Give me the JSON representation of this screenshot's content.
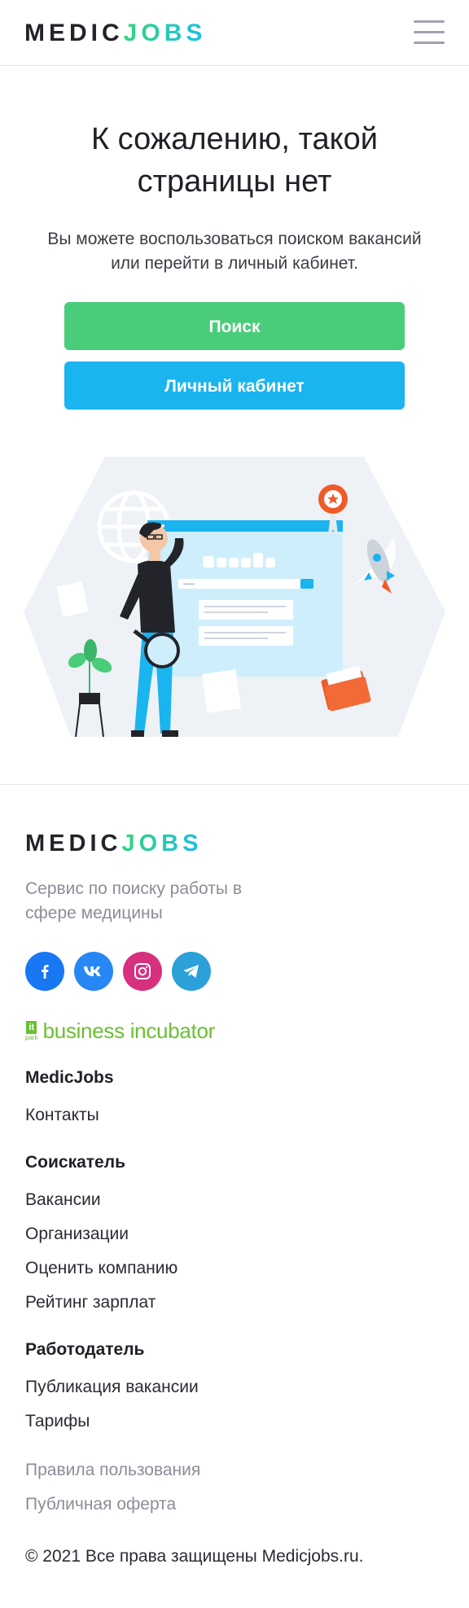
{
  "header": {
    "logo_part1": "MEDIC",
    "logo_part2": "JOBS"
  },
  "hero": {
    "title": "К сожалению, такой страницы нет",
    "subtitle": "Вы можете воспользоваться поиском вакансий или перейти в личный кабинет.",
    "search_button": "Поиск",
    "cabinet_button": "Личный кабинет"
  },
  "illustration": {
    "search_placeholder": "•••••"
  },
  "footer": {
    "logo_part1": "MEDIC",
    "logo_part2": "JOBS",
    "tagline": "Сервис по поиску работы в сфере медицины",
    "socials": [
      "facebook-icon",
      "vk-icon",
      "instagram-icon",
      "telegram-icon"
    ],
    "partner_badge_top": "it",
    "partner_badge_bottom": "park",
    "partner_text": "business incubator",
    "sections": [
      {
        "title": "MedicJobs",
        "links": [
          "Контакты"
        ]
      },
      {
        "title": "Соискатель",
        "links": [
          "Вакансии",
          "Организации",
          "Оценить компанию",
          "Рейтинг зарплат"
        ]
      },
      {
        "title": "Работодатель",
        "links": [
          "Публикация вакансии",
          "Тарифы"
        ]
      }
    ],
    "legal_links": [
      "Правила пользования",
      "Публичная оферта"
    ],
    "copyright": "© 2021 Все права защищены Medicjobs.ru."
  },
  "colors": {
    "search_button": "#49cd7a",
    "cabinet_button": "#1ab4ef",
    "facebook": "#1877f2",
    "vk": "#2787f5",
    "instagram": "#d6307f",
    "telegram": "#2ba0d9",
    "partner": "#6bbf33"
  }
}
